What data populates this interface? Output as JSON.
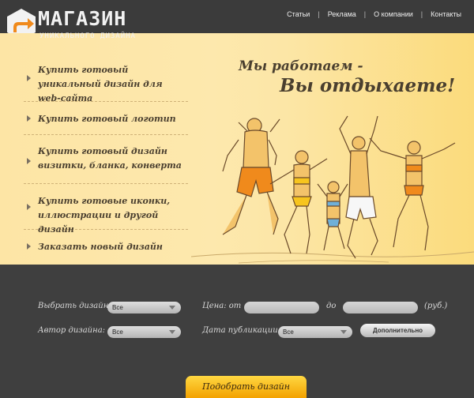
{
  "header": {
    "logo_title": "МАГАЗИН",
    "logo_subtitle": "УНИКАЛЬНОГО  ДИЗАЙНА",
    "nav": [
      "Статьи",
      "Реклама",
      "О компании",
      "Контакты"
    ],
    "nav_separator": "|"
  },
  "hero": {
    "menu": [
      {
        "label": "Купить готовый уникальный дизайн для web-сайта"
      },
      {
        "label": "Купить готовый логотип"
      },
      {
        "label": "Купить готовый дизайн визитки, бланка, конверта"
      },
      {
        "label": "Купить готовые иконки, иллюстрации и другой дизайн"
      },
      {
        "label": "Заказать новый дизайн"
      }
    ],
    "tagline_line1": "Мы работаем -",
    "tagline_line2": "Вы отдыхаете!"
  },
  "filter": {
    "design_label": "Выбрать дизайн:",
    "design_value": "Все",
    "price_label": "Цена: от",
    "price_from": "",
    "price_to_label": "до",
    "price_to": "",
    "currency": "(руб.)",
    "author_label": "Автор дизайна:",
    "author_value": "Все",
    "date_label": "Дата публикации:",
    "date_value": "Все",
    "more_button": "Дополнительно",
    "submit_button": "Подобрать дизайн"
  },
  "colors": {
    "accent_orange": "#f08a1c",
    "hero_bg": "#fde6a6",
    "dark_bg": "#3d3d3d",
    "button_yellow": "#ffc61e"
  },
  "icons": [
    "logo-arrow-icon",
    "menu-arrow-icon",
    "select-caret-icon"
  ]
}
